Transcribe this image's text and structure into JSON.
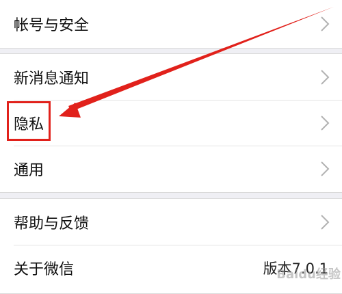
{
  "settings": {
    "account_security": "帐号与安全",
    "new_message_notify": "新消息通知",
    "privacy": "隐私",
    "general": "通用",
    "help_feedback": "帮助与反馈",
    "about_wechat": "关于微信",
    "version": "版本7.0.1"
  },
  "watermark": "Baidu经验",
  "colors": {
    "background": "#efeff4",
    "row_background": "#ffffff",
    "annotation_red": "#e1211b"
  }
}
